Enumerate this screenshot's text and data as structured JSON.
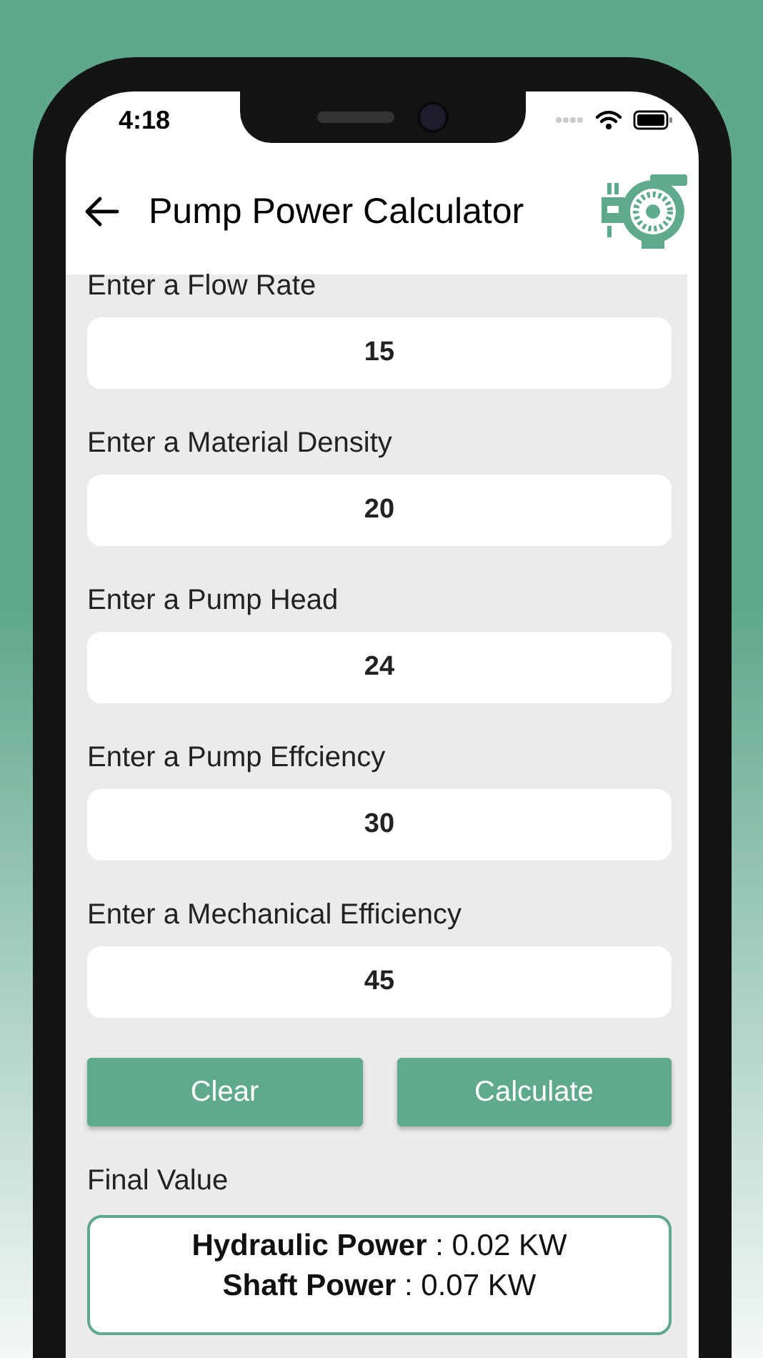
{
  "status_bar": {
    "time": "4:18"
  },
  "header": {
    "title": "Pump Power Calculator"
  },
  "fields": [
    {
      "label": "Enter a Flow Rate",
      "value": "15"
    },
    {
      "label": "Enter a Material Density",
      "value": "20"
    },
    {
      "label": "Enter a Pump Head",
      "value": "24"
    },
    {
      "label": "Enter a Pump Effciency",
      "value": "30"
    },
    {
      "label": "Enter a Mechanical Efficiency",
      "value": "45"
    }
  ],
  "buttons": [
    "Clear",
    "Calculate"
  ],
  "result": {
    "title": "Final Value",
    "lines": [
      "**Hydraulic Power** : 0.02 KW",
      "**Shaft Power** : 0.07 KW"
    ]
  }
}
